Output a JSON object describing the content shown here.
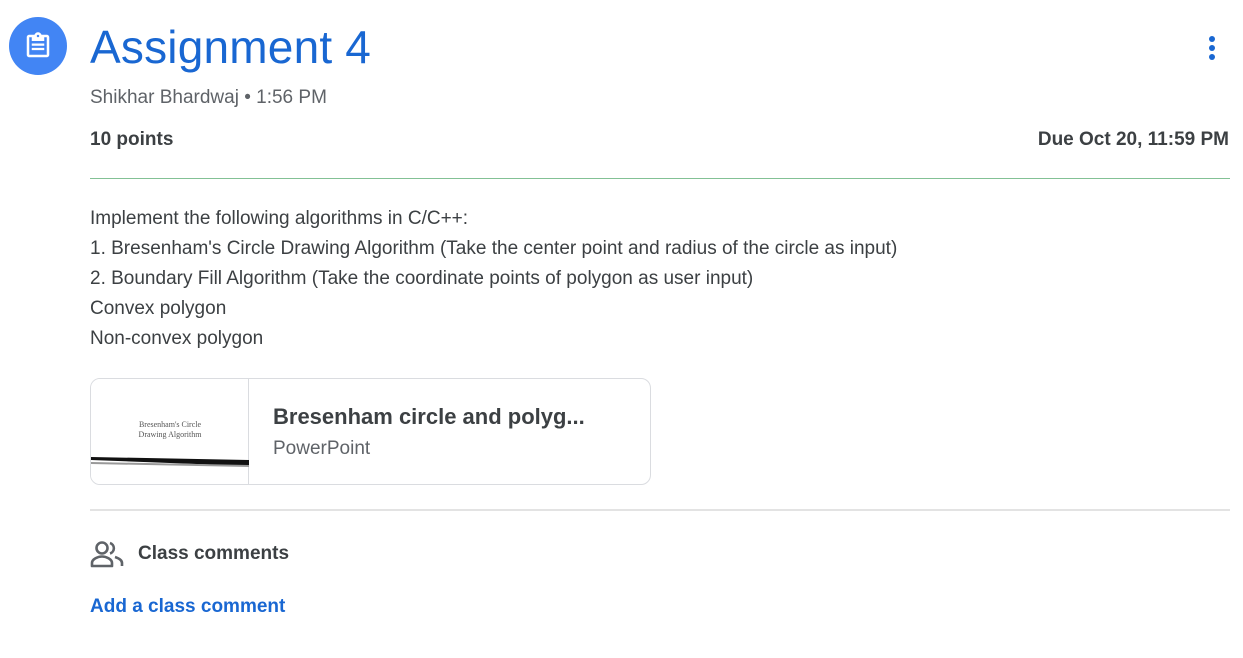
{
  "header": {
    "icon": "assignment-icon",
    "title": "Assignment 4",
    "author": "Shikhar Bhardwaj",
    "separator": "•",
    "time": "1:56 PM",
    "more_icon": "more-vert-icon"
  },
  "details": {
    "points": "10 points",
    "due": "Due Oct 20, 11:59 PM"
  },
  "description": {
    "lines": [
      "Implement the following algorithms in C/C++:",
      "1. Bresenham's Circle Drawing Algorithm (Take the center point and radius of the circle as input)",
      "2. Boundary Fill Algorithm (Take the coordinate points of polygon as user input)",
      "Convex polygon",
      "Non-convex polygon"
    ]
  },
  "attachment": {
    "title": "Bresenham circle and polyg...",
    "type": "PowerPoint",
    "thumbnail_text_line1": "Bresenham's Circle",
    "thumbnail_text_line2": "Drawing Algorithm"
  },
  "comments": {
    "icon": "people-icon",
    "label": "Class comments",
    "add_label": "Add a class comment"
  },
  "colors": {
    "accent": "#1967d2",
    "icon_bg": "#4285f4",
    "text": "#3c4043",
    "muted": "#5f6368"
  }
}
